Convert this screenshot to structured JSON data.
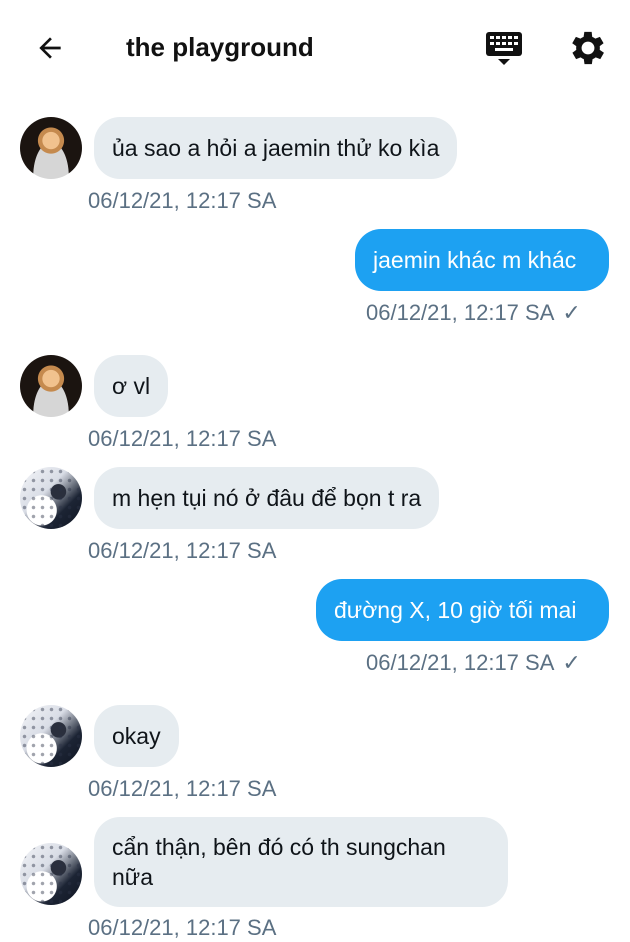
{
  "header": {
    "title": "the playground",
    "icons": [
      "back-arrow-icon",
      "keyboard-icon",
      "settings-gear-icon"
    ]
  },
  "messages": [
    {
      "side": "in",
      "text": "ủa sao a hỏi a jaemin thử ko kìa",
      "time": "06/12/21, 12:17 SA",
      "avatar": "a1"
    },
    {
      "side": "out",
      "text": "jaemin khác m khác",
      "time": "06/12/21, 12:17 SA",
      "read": "✓"
    },
    {
      "side": "in",
      "text": "ơ vl",
      "time": "06/12/21, 12:17 SA",
      "avatar": "a1"
    },
    {
      "side": "in",
      "text": "m hẹn tụi nó ở đâu để bọn t ra",
      "time": "06/12/21, 12:17 SA",
      "avatar": "a2"
    },
    {
      "side": "out",
      "text": "đường X, 10 giờ tối mai",
      "time": "06/12/21, 12:17 SA",
      "read": "✓"
    },
    {
      "side": "in",
      "text": "okay",
      "time": "06/12/21, 12:17 SA",
      "avatar": "a2"
    },
    {
      "side": "in",
      "text_line1": "cẩn thận, bên đó có th sungchan",
      "text_line2": "nữa",
      "time": "06/12/21, 12:17 SA",
      "avatar": "a2"
    }
  ],
  "colors": {
    "incoming_bubble": "#e6ecf0",
    "outgoing_bubble": "#1da1f2",
    "timestamp": "#5b7083"
  }
}
